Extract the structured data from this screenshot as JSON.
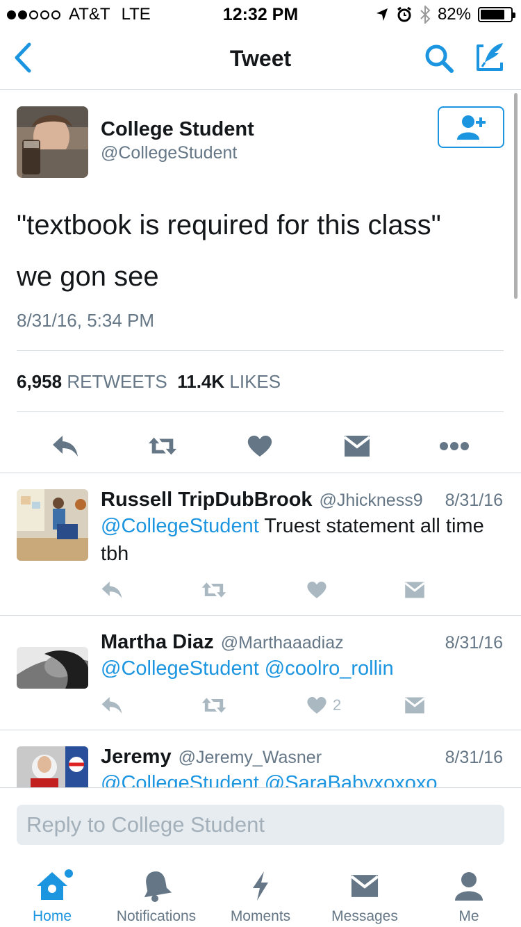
{
  "status_bar": {
    "carrier": "AT&T",
    "network": "LTE",
    "time": "12:32 PM",
    "battery_percent": "82%",
    "battery_level": 0.82,
    "signal_bars": 2
  },
  "nav": {
    "title": "Tweet"
  },
  "tweet": {
    "name": "College Student",
    "handle": "@CollegeStudent",
    "text_line1": "\"textbook is required for this class\"",
    "text_line2": "we gon see",
    "date": "8/31/16, 5:34 PM",
    "retweets_count": "6,958",
    "retweets_label": "RETWEETS",
    "likes_count": "11.4K",
    "likes_label": "LIKES"
  },
  "replies": [
    {
      "name": "Russell TripDubBrook",
      "handle": "@Jhickness9",
      "date": "8/31/16",
      "mention": "@CollegeStudent",
      "text": " Truest statement all time tbh",
      "likes": ""
    },
    {
      "name": "Martha Diaz",
      "handle": "@Marthaaadiaz",
      "date": "8/31/16",
      "mention": "@CollegeStudent @coolro_rollin",
      "text": "",
      "likes": "2"
    },
    {
      "name": "Jeremy",
      "handle": "@Jeremy_Wasner",
      "date": "8/31/16",
      "mention": "@CollegeStudent @SaraBabyxoxoxo",
      "text": "",
      "likes": ""
    }
  ],
  "reply_bar": {
    "placeholder": "Reply to College Student"
  },
  "tabs": [
    {
      "label": "Home",
      "active": true
    },
    {
      "label": "Notifications"
    },
    {
      "label": "Moments"
    },
    {
      "label": "Messages"
    },
    {
      "label": "Me"
    }
  ],
  "colors": {
    "accent": "#1b95e0",
    "icon_gray": "#657786",
    "light_icon_gray": "#aab8c2"
  }
}
